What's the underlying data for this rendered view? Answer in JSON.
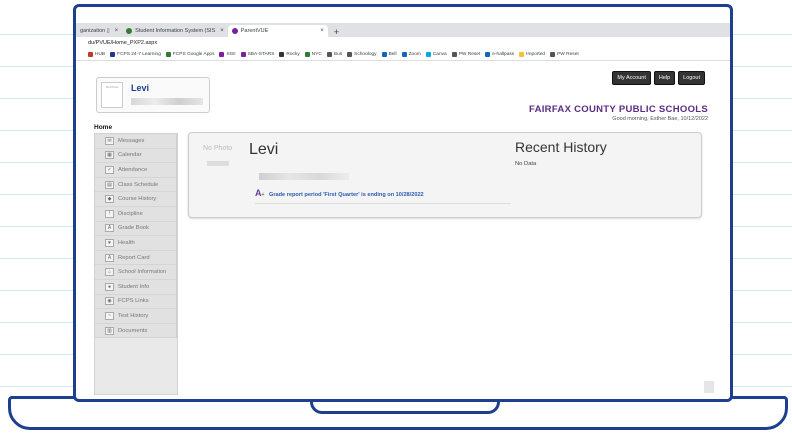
{
  "browser": {
    "tabs": [
      {
        "label": "ganization ▯",
        "active": false
      },
      {
        "label": "Student Information System (SIS",
        "active": false
      },
      {
        "label": "ParentVUE",
        "active": true
      }
    ],
    "new_tab": "+",
    "close_glyph": "×",
    "url": "du/PVUE/Home_PXP2.aspx",
    "bookmarks": [
      "HUB",
      "FCPS 24-7 Learning",
      "FCPS Google Apps",
      "SISI",
      "SBA-STARS",
      "Rocky",
      "NYC",
      "Bus",
      "Schoology",
      "Bell",
      "Zoom",
      "Canva",
      "PW Reset",
      "e-hallpass",
      "Imported",
      "PW Reset"
    ],
    "bookmark_colors": [
      "#c0392b",
      "#1e3a8a",
      "#2e7d32",
      "#7b1fa2",
      "#7b1fa2",
      "#333333",
      "#2e7d32",
      "#555555",
      "#555555",
      "#1565c0",
      "#1565c0",
      "#00a8e8",
      "#555555",
      "#1565c0",
      "#f4c430",
      "#555555"
    ]
  },
  "header": {
    "buttons": [
      "My Account",
      "Help",
      "Logout"
    ],
    "school": "FAIRFAX COUNTY PUBLIC SCHOOLS",
    "greeting": "Good morning, Esther Bae, 10/12/2022",
    "card_photo_text": "No Photo",
    "student_name": "Levi"
  },
  "nav": {
    "home": "Home",
    "items": [
      {
        "label": "Messages",
        "icon": "envelope-icon",
        "glyph": "✉"
      },
      {
        "label": "Calendar",
        "icon": "calendar-icon",
        "glyph": "▦"
      },
      {
        "label": "Attendance",
        "icon": "checkbox-icon",
        "glyph": "✓"
      },
      {
        "label": "Class Schedule",
        "icon": "schedule-icon",
        "glyph": "▤"
      },
      {
        "label": "Course History",
        "icon": "history-icon",
        "glyph": "◆"
      },
      {
        "label": "Discipline",
        "icon": "alert-icon",
        "glyph": "!"
      },
      {
        "label": "Grade Book",
        "icon": "gradebook-icon",
        "glyph": "A"
      },
      {
        "label": "Health",
        "icon": "health-icon",
        "glyph": "♥"
      },
      {
        "label": "Report Card",
        "icon": "report-card-icon",
        "glyph": "A"
      },
      {
        "label": "School Information",
        "icon": "school-icon",
        "glyph": "⌂"
      },
      {
        "label": "Student Info",
        "icon": "person-icon",
        "glyph": "●"
      },
      {
        "label": "FCPS Links",
        "icon": "people-icon",
        "glyph": "◉"
      },
      {
        "label": "Test History",
        "icon": "test-icon",
        "glyph": "~"
      },
      {
        "label": "Documents",
        "icon": "documents-icon",
        "glyph": "▥"
      }
    ]
  },
  "panel": {
    "photo_text": "No Photo",
    "student_name": "Levi",
    "grade_notice": "Grade report period 'First Quarter' is ending on 10/28/2022",
    "recent_title": "Recent History",
    "recent_empty": "No Data"
  }
}
